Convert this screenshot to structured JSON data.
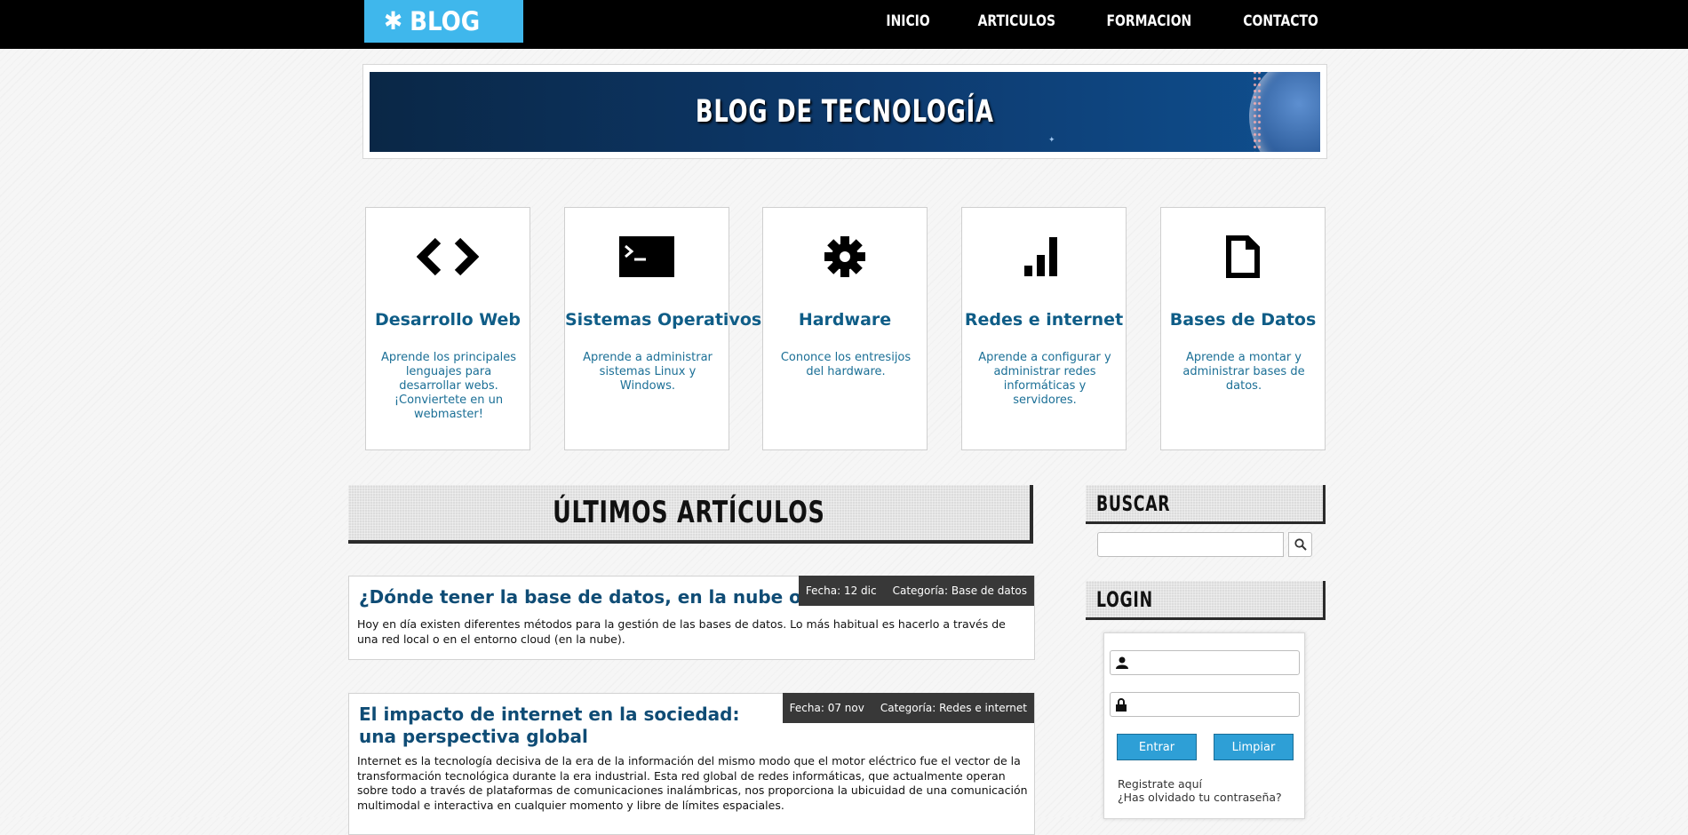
{
  "header": {
    "logo_text": "BLOG",
    "logo_icon": "gear-icon",
    "nav": [
      "INICIO",
      "ARTICULOS",
      "FORMACION",
      "CONTACTO"
    ]
  },
  "banner": {
    "title": "BLOG DE TECNOLOGÍA"
  },
  "categories": [
    {
      "icon": "code-icon",
      "title": "Desarrollo Web",
      "description": "Aprende los principales lenguajes para desarrollar webs. ¡Conviertete en un webmaster!"
    },
    {
      "icon": "terminal-icon",
      "title": "Sistemas Operativos",
      "description": "Aprende a administrar sistemas Linux y Windows."
    },
    {
      "icon": "cog-icon",
      "title": "Hardware",
      "description": "Cononce los entresijos del hardware."
    },
    {
      "icon": "signal-icon",
      "title": "Redes e internet",
      "description": "Aprende a configurar y administrar redes informáticas y servidores."
    },
    {
      "icon": "file-icon",
      "title": "Bases de Datos",
      "description": "Aprende a montar y administrar bases de datos."
    }
  ],
  "articles_section": {
    "title": "ÚLTIMOS ARTÍCULOS"
  },
  "articles": [
    {
      "title": "¿Dónde tener la base de datos, en la nube o local?",
      "date": "Fecha: 12 dic",
      "category": "Categoría: Base de datos",
      "excerpt": "Hoy en día existen diferentes métodos para la gestión de las bases de datos. Lo más habitual es hacerlo a través de una red local o en el entorno cloud (en la nube)."
    },
    {
      "title": "El impacto de internet en la sociedad: una perspectiva global",
      "date": "Fecha: 07 nov",
      "category": "Categoría: Redes e internet",
      "excerpt": "Internet es la tecnología decisiva de la era de la información del mismo modo que el motor eléctrico fue el vector de la transformación tecnológica durante la era industrial. Esta red global de redes informáticas, que actualmente operan sobre todo a través de plataformas de comunicaciones inalámbricas, nos proporciona la ubicuidad de una comunicación multimodal e interactiva en cualquier momento y libre de límites espaciales."
    }
  ],
  "sidebar": {
    "search_title": "BUSCAR",
    "search_value": "",
    "login_title": "LOGIN",
    "username_value": "",
    "password_value": "",
    "login_button": "Entrar",
    "clear_button": "Limpiar",
    "register_link": "Registrate aquí",
    "forgot_link": "¿Has olvidado tu contraseña?"
  },
  "colors": {
    "accent": "#3fb7ec",
    "title_blue": "#0f5d87",
    "button_blue": "#2e9fd6",
    "meta_bg": "#383838"
  }
}
